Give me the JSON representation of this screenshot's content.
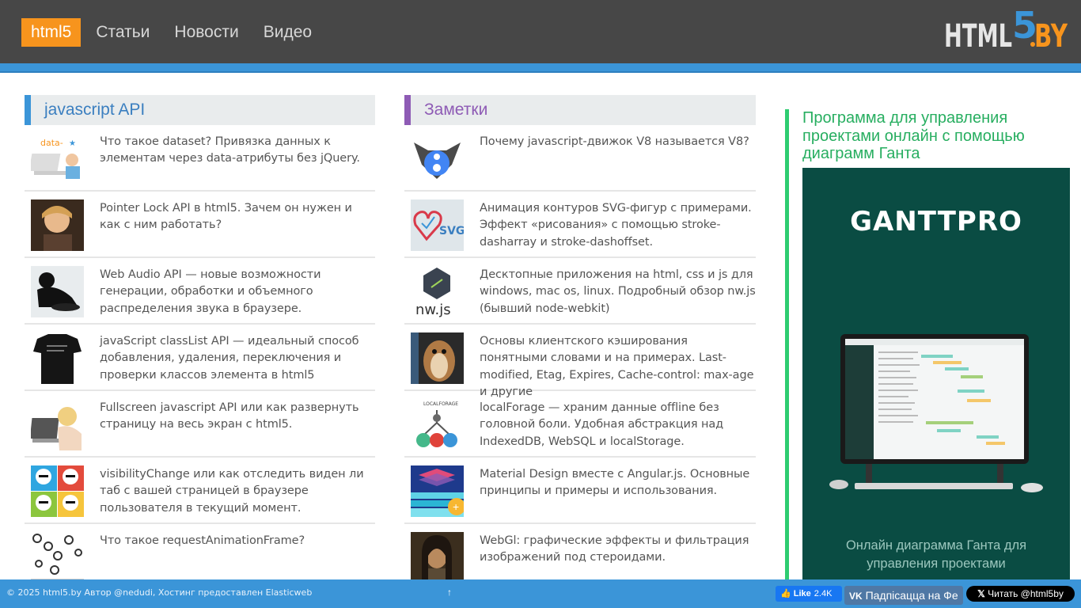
{
  "nav": {
    "items": [
      {
        "label": "html5",
        "active": true
      },
      {
        "label": "Статьи"
      },
      {
        "label": "Новости"
      },
      {
        "label": "Видео"
      }
    ],
    "logo_text": "HTML5.BY"
  },
  "left_column": {
    "title": "javascript API",
    "items": [
      {
        "text": "Что такое dataset? Привязка данных к элементам через data-атрибуты без jQuery.",
        "thumb": "dataset-icon"
      },
      {
        "text": "Pointer Lock API в html5. Зачем он нужен и как с ним работать?",
        "thumb": "pointer-lock-icon"
      },
      {
        "text": "Web Audio API — новые возможности генерации, обработки и объемного распределения звука в браузере.",
        "thumb": "web-audio-icon"
      },
      {
        "text": "javaScript classList API — идеальный способ добавления, удаления, переключения и проверки классов элемента в html5",
        "thumb": "classlist-icon"
      },
      {
        "text": "Fullscreen javascript API или как развернуть страницу на весь экран с html5.",
        "thumb": "fullscreen-icon"
      },
      {
        "text": "visibilityChange или как отследить виден ли таб с вашей страницей в браузере пользователя в текущий момент.",
        "thumb": "visibility-icon"
      },
      {
        "text": "Что такое requestAnimationFrame?",
        "thumb": "raf-icon"
      }
    ]
  },
  "mid_column": {
    "title": "Заметки",
    "items": [
      {
        "text": "Почему javascript-движок V8 называется V8?",
        "thumb": "v8-icon"
      },
      {
        "text": "Анимация контуров SVG-фигур с примерами. Эффект «рисования» с помощью stroke-dasharray и stroke-dashoffset.",
        "thumb": "svg-heart-icon"
      },
      {
        "text": "Десктопные приложения на html, css и js для windows, mac os, linux. Подробный обзор nw.js (бывший node-webkit)",
        "thumb": "nwjs-icon"
      },
      {
        "text": "Основы клиентского кэширования понятными словами и на примерах. Last-modified, Etag, Expires, Cache-control: max-age и другие",
        "thumb": "squirrel-icon"
      },
      {
        "text": "localForage — храним данные offline без головной боли. Удобная абстракция над IndexedDB, WebSQL и localStorage.",
        "thumb": "localforage-icon"
      },
      {
        "text": "Material Design вместе с Angular.js. Основные принципы и примеры и использования.",
        "thumb": "material-icon"
      },
      {
        "text": "WebGl: графические эффекты и фильтрация изображений под стероидами.",
        "thumb": "webgl-icon"
      }
    ]
  },
  "sidebar": {
    "title": "Программа для управления проектами онлайн с помощью диаграмм Ганта",
    "ad_logo": "GANTTPRO",
    "ad_caption_1": "Онлайн диаграмма Ганта для",
    "ad_caption_2": "управления проектами"
  },
  "footer": {
    "copy": "© 2025 html5.by Автор @nedudi, Хостинг предоставлен Elasticweb",
    "up": "↑",
    "fb_label": "Like",
    "fb_count": "2.4K",
    "vk_label": "Падпісацца на Фе",
    "tw_label": "Читать @html5by"
  }
}
